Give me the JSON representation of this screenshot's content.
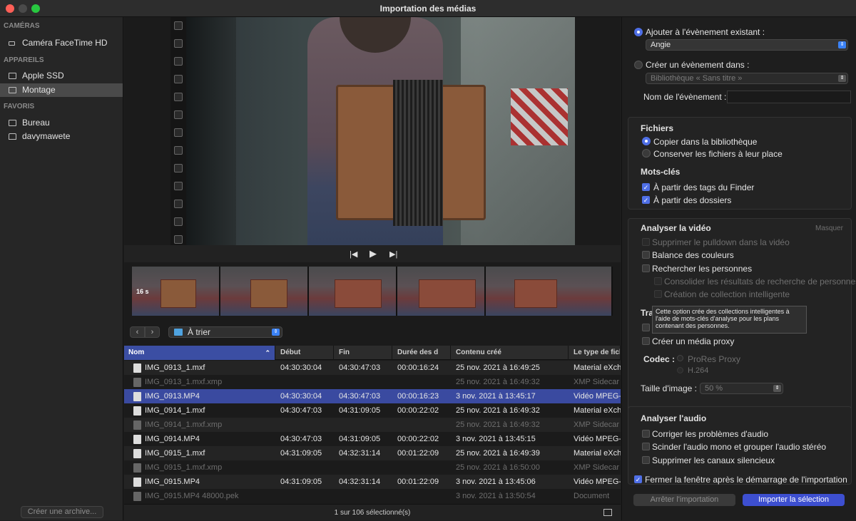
{
  "window": {
    "title": "Importation des médias"
  },
  "sidebar": {
    "sections": [
      {
        "header": "CAMÉRAS",
        "items": [
          {
            "label": "Caméra FaceTime HD"
          }
        ]
      },
      {
        "header": "APPAREILS",
        "items": [
          {
            "label": "Apple SSD"
          },
          {
            "label": "Montage"
          }
        ]
      },
      {
        "header": "FAVORIS",
        "items": [
          {
            "label": "Bureau"
          },
          {
            "label": "davymawete"
          }
        ]
      }
    ],
    "selected_item": "Montage",
    "archive_button": "Créer une archive..."
  },
  "viewer": {
    "timestamp_label": "16 s"
  },
  "browser": {
    "folder": "À trier",
    "columns": [
      "Nom",
      "Début",
      "Fin",
      "Durée des d",
      "Contenu créé",
      "Le type de fichi"
    ],
    "rows": [
      {
        "name": "IMG_0913_1.mxf",
        "start": "04:30:30:04",
        "end": "04:30:47:03",
        "duration": "00:00:16:24",
        "created": "25 nov. 2021 à 16:49:25",
        "type": "Material eXch",
        "dim": false
      },
      {
        "name": "IMG_0913_1.mxf.xmp",
        "start": "",
        "end": "",
        "duration": "",
        "created": "25 nov. 2021 à 16:49:32",
        "type": "XMP Sidecar",
        "dim": true
      },
      {
        "name": "IMG_0913.MP4",
        "start": "04:30:30:04",
        "end": "04:30:47:03",
        "duration": "00:00:16:23",
        "created": "3 nov. 2021 à 13:45:17",
        "type": "Vidéo MPEG-",
        "dim": false
      },
      {
        "name": "IMG_0914_1.mxf",
        "start": "04:30:47:03",
        "end": "04:31:09:05",
        "duration": "00:00:22:02",
        "created": "25 nov. 2021 à 16:49:32",
        "type": "Material eXch",
        "dim": false
      },
      {
        "name": "IMG_0914_1.mxf.xmp",
        "start": "",
        "end": "",
        "duration": "",
        "created": "25 nov. 2021 à 16:49:32",
        "type": "XMP Sidecar",
        "dim": true
      },
      {
        "name": "IMG_0914.MP4",
        "start": "04:30:47:03",
        "end": "04:31:09:05",
        "duration": "00:00:22:02",
        "created": "3 nov. 2021 à 13:45:15",
        "type": "Vidéo MPEG-",
        "dim": false
      },
      {
        "name": "IMG_0915_1.mxf",
        "start": "04:31:09:05",
        "end": "04:32:31:14",
        "duration": "00:01:22:09",
        "created": "25 nov. 2021 à 16:49:39",
        "type": "Material eXch",
        "dim": false
      },
      {
        "name": "IMG_0915_1.mxf.xmp",
        "start": "",
        "end": "",
        "duration": "",
        "created": "25 nov. 2021 à 16:50:00",
        "type": "XMP Sidecar",
        "dim": true
      },
      {
        "name": "IMG_0915.MP4",
        "start": "04:31:09:05",
        "end": "04:32:31:14",
        "duration": "00:01:22:09",
        "created": "3 nov. 2021 à 13:45:06",
        "type": "Vidéo MPEG-",
        "dim": false
      },
      {
        "name": "IMG_0915.MP4 48000.pek",
        "start": "",
        "end": "",
        "duration": "",
        "created": "3 nov. 2021 à 13:50:54",
        "type": "Document",
        "dim": true
      }
    ],
    "selected_row": "IMG_0913.MP4",
    "status": "1 sur 106 sélectionné(s)"
  },
  "options": {
    "existing_event_label": "Ajouter à l'évènement existant :",
    "existing_event_value": "Angie",
    "new_event_label": "Créer un évènement dans :",
    "new_event_library": "Bibliothèque « Sans titre »",
    "event_name_label": "Nom de l'évènement :",
    "files_title": "Fichiers",
    "copy_label": "Copier dans la bibliothèque",
    "keep_label": "Conserver les fichiers à leur place",
    "keywords_title": "Mots-clés",
    "finder_tags_label": "À partir des tags du Finder",
    "folders_label": "À partir des dossiers",
    "analyze_video_title": "Analyser la vidéo",
    "hide_label": "Masquer",
    "pulldown_label": "Supprimer le pulldown dans la vidéo",
    "color_balance_label": "Balance des couleurs",
    "find_people_label": "Rechercher les personnes",
    "consolidate_label": "Consolider les résultats de recherche de personnes",
    "smart_collection_label": "Création de collection intelligente",
    "transcode_partial": "Tra",
    "proxy_label": "Créer un média proxy",
    "codec_label": "Codec :",
    "codec_options": [
      "ProRes Proxy",
      "H.264"
    ],
    "image_size_label": "Taille d'image :",
    "image_size_value": "50 %",
    "analyze_audio_title": "Analyser l'audio",
    "audio_fix_label": "Corriger les problèmes d'audio",
    "split_mono_label": "Scinder l'audio mono et grouper l'audio stéréo",
    "silent_channels_label": "Supprimer les canaux silencieux",
    "close_window_label": "Fermer la fenêtre après le démarrage de l'importation",
    "stop_button": "Arrêter l'importation",
    "import_button": "Importer la sélection",
    "tooltip": "Cette option crée des collections intelligentes à l'aide de mots-clés d'analyse pour les plans contenant des personnes."
  },
  "colors": {
    "accent": "#4f6fe6",
    "selection": "#3a4aa0"
  }
}
